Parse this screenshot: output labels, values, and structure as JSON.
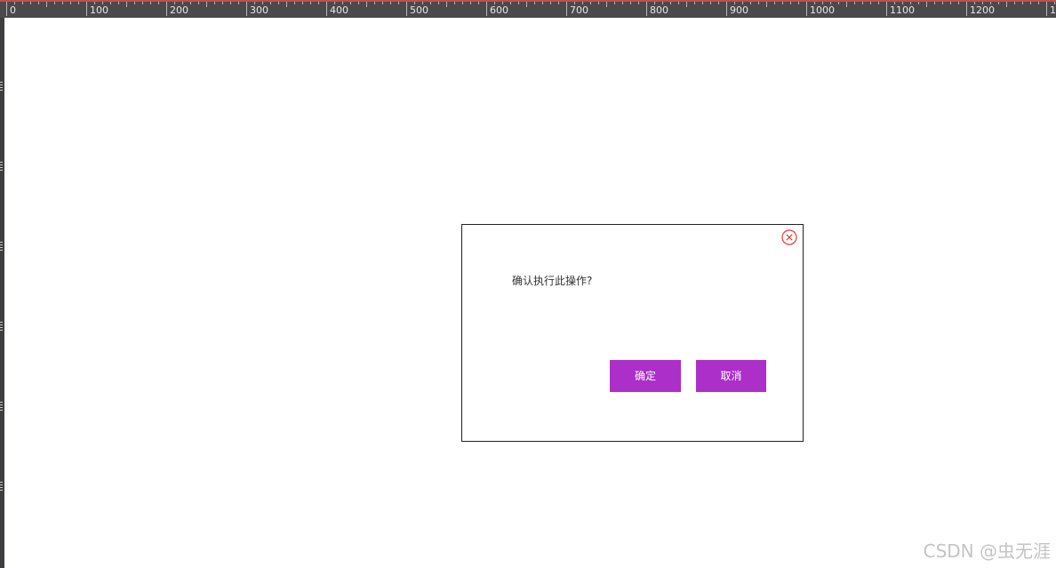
{
  "ruler": {
    "labels": [
      "0",
      "100",
      "200",
      "300",
      "400",
      "500",
      "600",
      "700",
      "800",
      "900",
      "1000",
      "1100",
      "1200",
      "1"
    ]
  },
  "dialog": {
    "message": "确认执行此操作?",
    "confirm_label": "确定",
    "cancel_label": "取消",
    "close_icon": "circle-x-icon"
  },
  "colors": {
    "button_bg": "#ab2fc8",
    "close_icon": "#e53935",
    "border": "#222222"
  },
  "watermark": "CSDN @虫无涯"
}
